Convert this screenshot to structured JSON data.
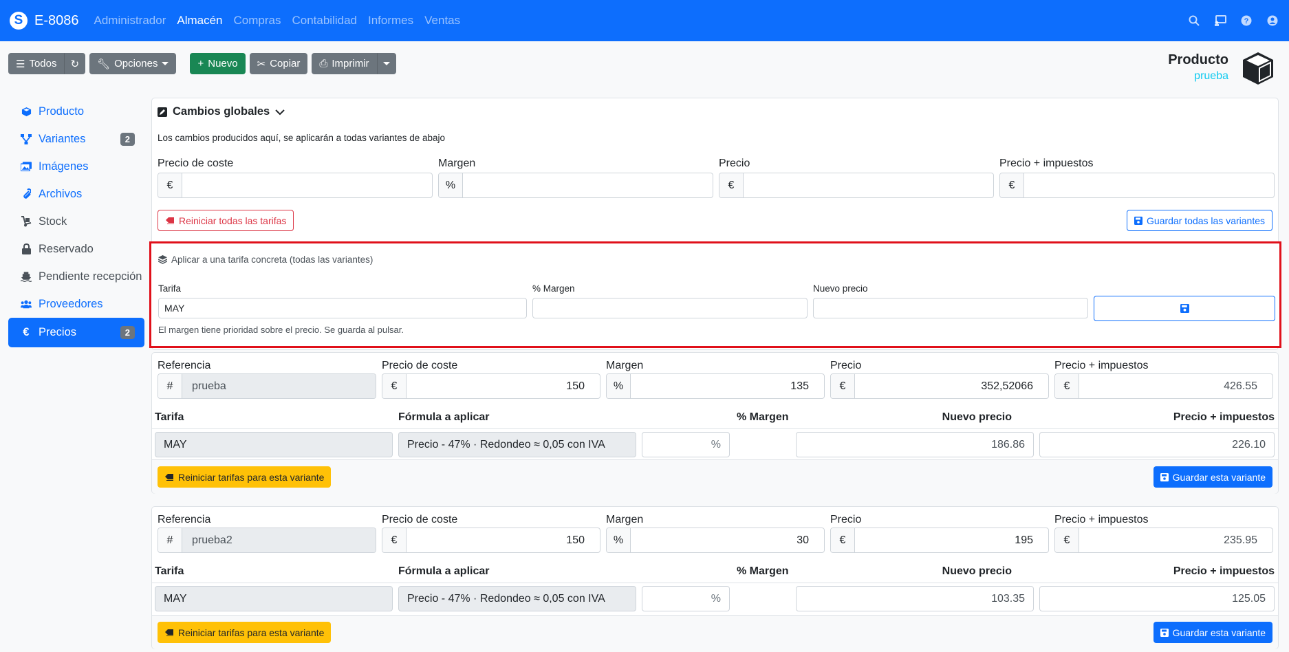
{
  "nav": {
    "brand": "E-8086",
    "items": [
      "Administrador",
      "Almacén",
      "Compras",
      "Contabilidad",
      "Informes",
      "Ventas"
    ],
    "active": "Almacén"
  },
  "toolbar": {
    "todos": "Todos",
    "opciones": "Opciones",
    "nuevo": "Nuevo",
    "copiar": "Copiar",
    "imprimir": "Imprimir"
  },
  "header": {
    "title": "Producto",
    "subtitle": "prueba"
  },
  "sidebar": {
    "items": [
      {
        "label": "Producto",
        "icon": "cube-icon"
      },
      {
        "label": "Variantes",
        "icon": "sitemap-icon",
        "badge": "2"
      },
      {
        "label": "Imágenes",
        "icon": "images-icon"
      },
      {
        "label": "Archivos",
        "icon": "paperclip-icon"
      },
      {
        "label": "Stock",
        "icon": "dolly-icon"
      },
      {
        "label": "Reservado",
        "icon": "lock-icon"
      },
      {
        "label": "Pendiente recepción",
        "icon": "ship-icon"
      },
      {
        "label": "Proveedores",
        "icon": "users-icon"
      },
      {
        "label": "Precios",
        "icon": "euro-icon",
        "badge": "2"
      }
    ]
  },
  "global": {
    "title": "Cambios globales",
    "description": "Los cambios producidos aquí, se aplicarán a todas variantes de abajo",
    "labels": [
      "Precio de coste",
      "Margen",
      "Precio",
      "Precio + impuestos"
    ],
    "addons": [
      "€",
      "%",
      "€",
      "€"
    ],
    "reset_label": "Reiniciar todas las tarifas",
    "save_label": "Guardar todas las variantes"
  },
  "tariff_apply": {
    "title": "Aplicar a una tarifa concreta (todas las variantes)",
    "tarifa_label": "Tarifa",
    "tarifa_value": "MAY",
    "margin_label": "% Margen",
    "price_label": "Nuevo precio",
    "note": "El margen tiene prioridad sobre el precio. Se guarda al pulsar."
  },
  "variant_labels": {
    "ref": "Referencia",
    "cost": "Precio de coste",
    "margin": "Margen",
    "price": "Precio",
    "price_tax": "Precio + impuestos",
    "th_tarifa": "Tarifa",
    "th_formula": "Fórmula a aplicar",
    "th_margin": "% Margen",
    "th_newprice": "Nuevo precio",
    "th_pricetax": "Precio + impuestos",
    "reset": "Reiniciar tarifas para esta variante",
    "save": "Guardar esta variante",
    "hash": "#",
    "euro": "€",
    "percent": "%"
  },
  "variants": [
    {
      "ref": "prueba",
      "cost": "150",
      "margin": "135",
      "price": "352,52066",
      "price_tax": "426.55",
      "rate": {
        "tarifa": "MAY",
        "formula": "Precio - 47% · Redondeo ≈ 0,05 con IVA",
        "margin_unit": "%",
        "new_price": "186.86",
        "price_tax": "226.10"
      }
    },
    {
      "ref": "prueba2",
      "cost": "150",
      "margin": "30",
      "price": "195",
      "price_tax": "235.95",
      "rate": {
        "tarifa": "MAY",
        "formula": "Precio - 47% · Redondeo ≈ 0,05 con IVA",
        "margin_unit": "%",
        "new_price": "103.35",
        "price_tax": "125.05"
      }
    }
  ],
  "colors": {
    "primary": "#0d6efd",
    "secondary": "#6c757d",
    "success": "#198754",
    "warning": "#ffc107",
    "danger": "#dc3545",
    "highlight": "#e0101a"
  }
}
